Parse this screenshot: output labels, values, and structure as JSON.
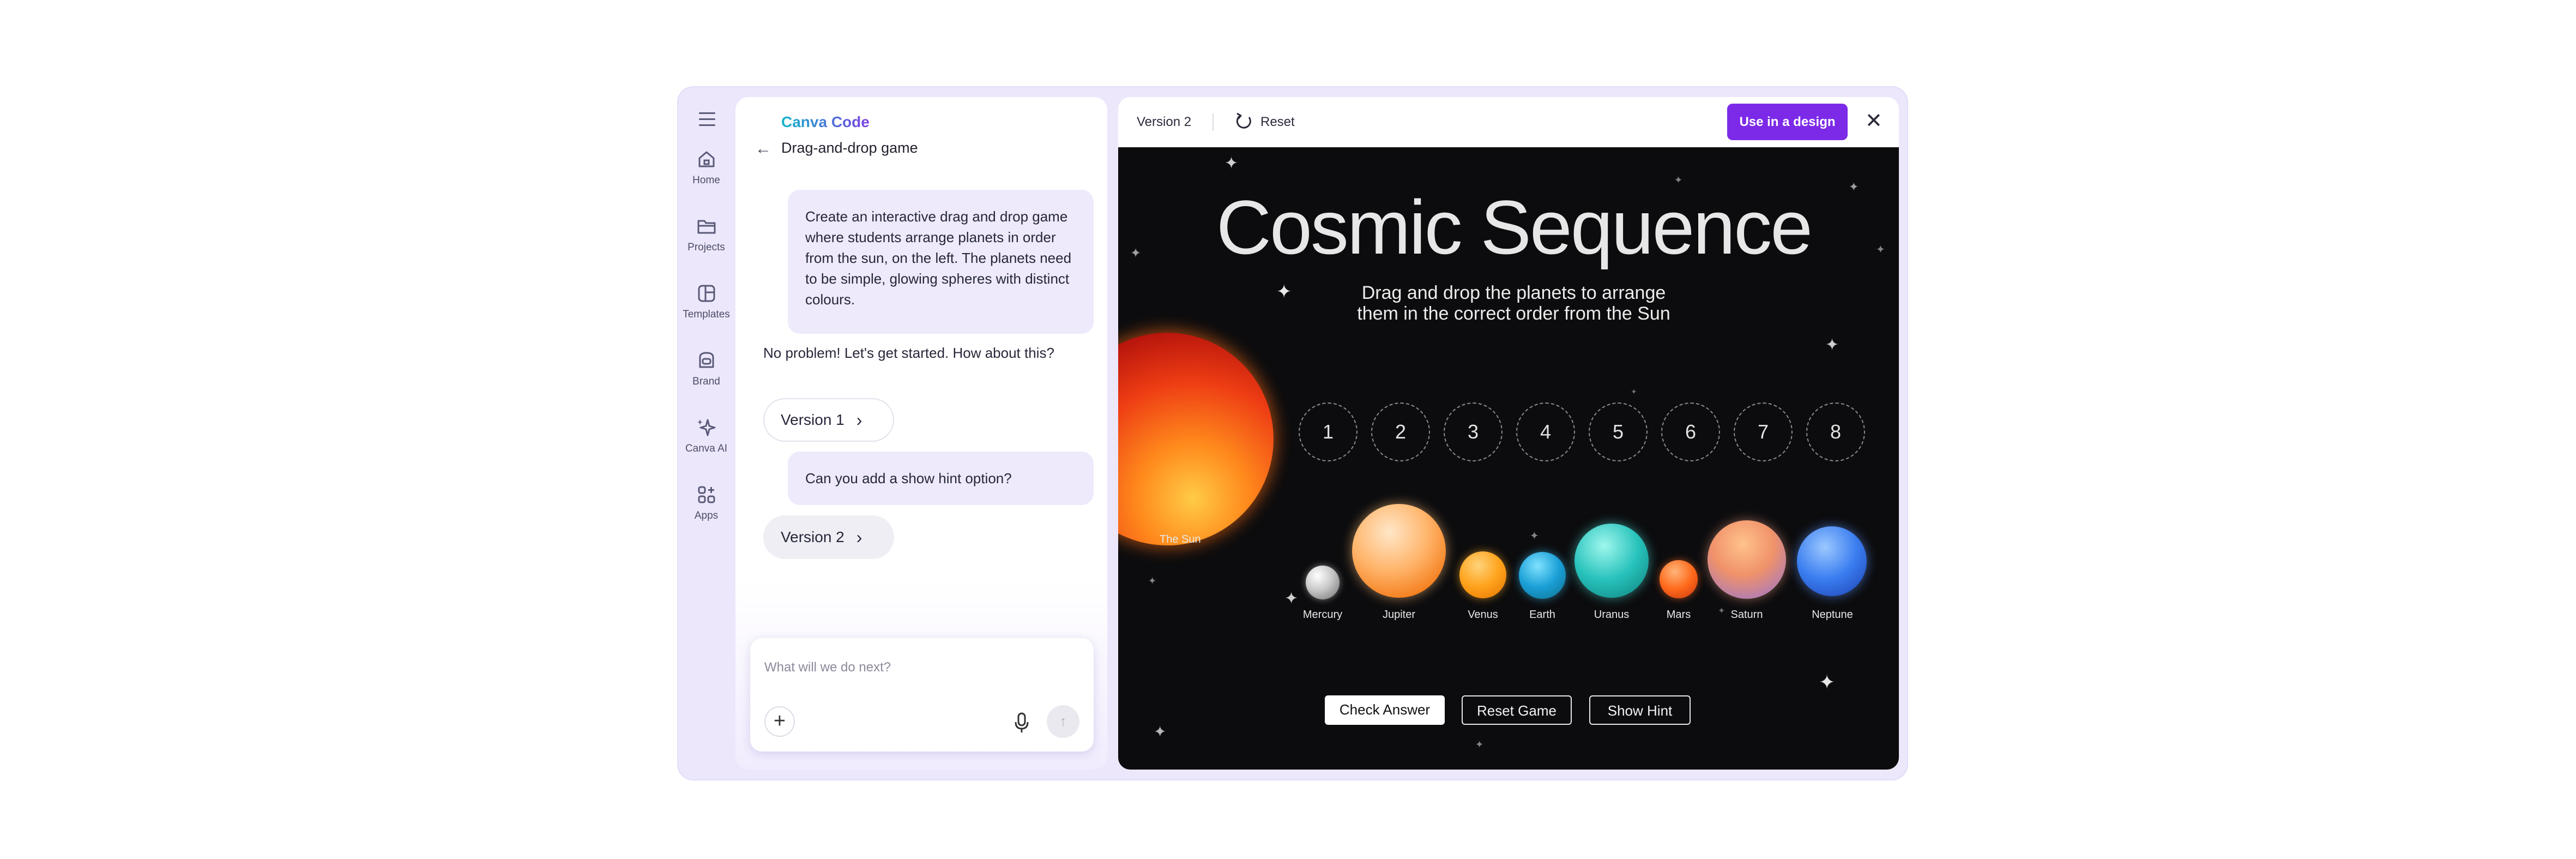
{
  "rail": {
    "items": [
      {
        "label": "Home",
        "icon": "home-icon"
      },
      {
        "label": "Projects",
        "icon": "folder-icon"
      },
      {
        "label": "Templates",
        "icon": "templates-icon"
      },
      {
        "label": "Brand",
        "icon": "brand-icon"
      },
      {
        "label": "Canva AI",
        "icon": "sparkle-icon"
      },
      {
        "label": "Apps",
        "icon": "apps-icon"
      }
    ]
  },
  "chat": {
    "brand": "Canva Code",
    "title": "Drag-and-drop game",
    "messages": {
      "user1": "Create an interactive drag and drop game where students arrange planets in order from the sun, on the left. The planets need to be simple, glowing spheres with distinct colours.",
      "assistant1": "No problem! Let's get started. How about this?",
      "version1": "Version 1",
      "user2": "Can you add a show hint option?",
      "version2": "Version 2"
    },
    "input_placeholder": "What will we do next?"
  },
  "preview": {
    "version_label": "Version 2",
    "reset_label": "Reset",
    "use_button": "Use in a design",
    "accent_color": "#7d2ae8"
  },
  "game": {
    "title": "Cosmic Sequence",
    "subtitle_line1": "Drag and drop the planets to arrange",
    "subtitle_line2": "them in the correct order from the Sun",
    "slots": [
      "1",
      "2",
      "3",
      "4",
      "5",
      "6",
      "7",
      "8"
    ],
    "sun_label": "The Sun",
    "planets": [
      "Mercury",
      "Jupiter",
      "Venus",
      "Earth",
      "Uranus",
      "Mars",
      "Saturn",
      "Neptune"
    ],
    "buttons": {
      "check": "Check Answer",
      "reset": "Reset Game",
      "hint": "Show Hint"
    }
  }
}
